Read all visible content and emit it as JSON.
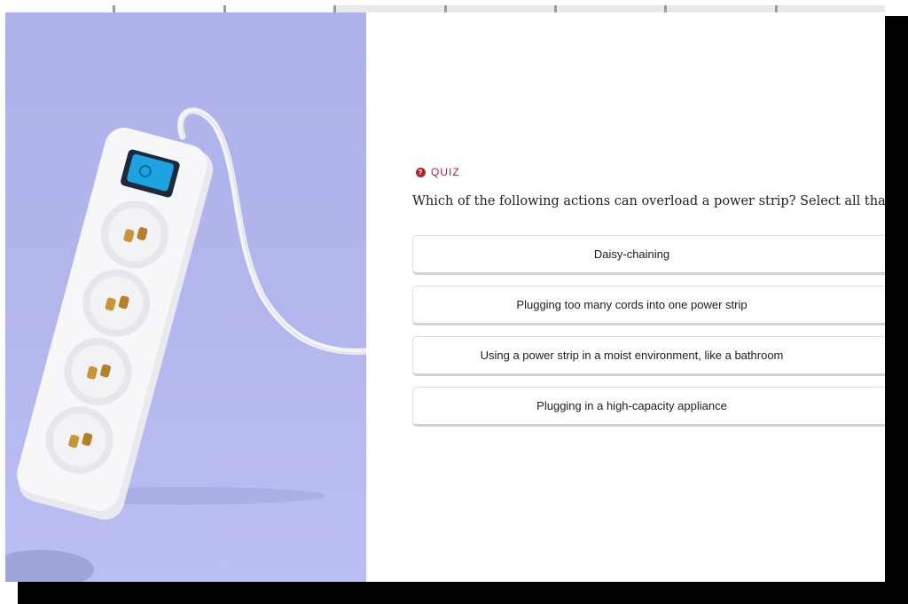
{
  "progress": {
    "segments_total": 8,
    "segments_completed": 3
  },
  "image": {
    "subject": "white power strip on lavender background",
    "background_color": "#b1b5ec"
  },
  "quiz": {
    "tag_label": "QUIZ",
    "question": "Which of the following actions can overload a power strip? Select all that apply.",
    "options": [
      {
        "label": "Daisy-chaining"
      },
      {
        "label": "Plugging too many cords into one power strip"
      },
      {
        "label": "Using a power strip in a moist environment, like a bathroom"
      },
      {
        "label": "Plugging in a high-capacity appliance"
      }
    ]
  },
  "colors": {
    "accent": "#b3212f",
    "switch": "#1fa3e0"
  }
}
